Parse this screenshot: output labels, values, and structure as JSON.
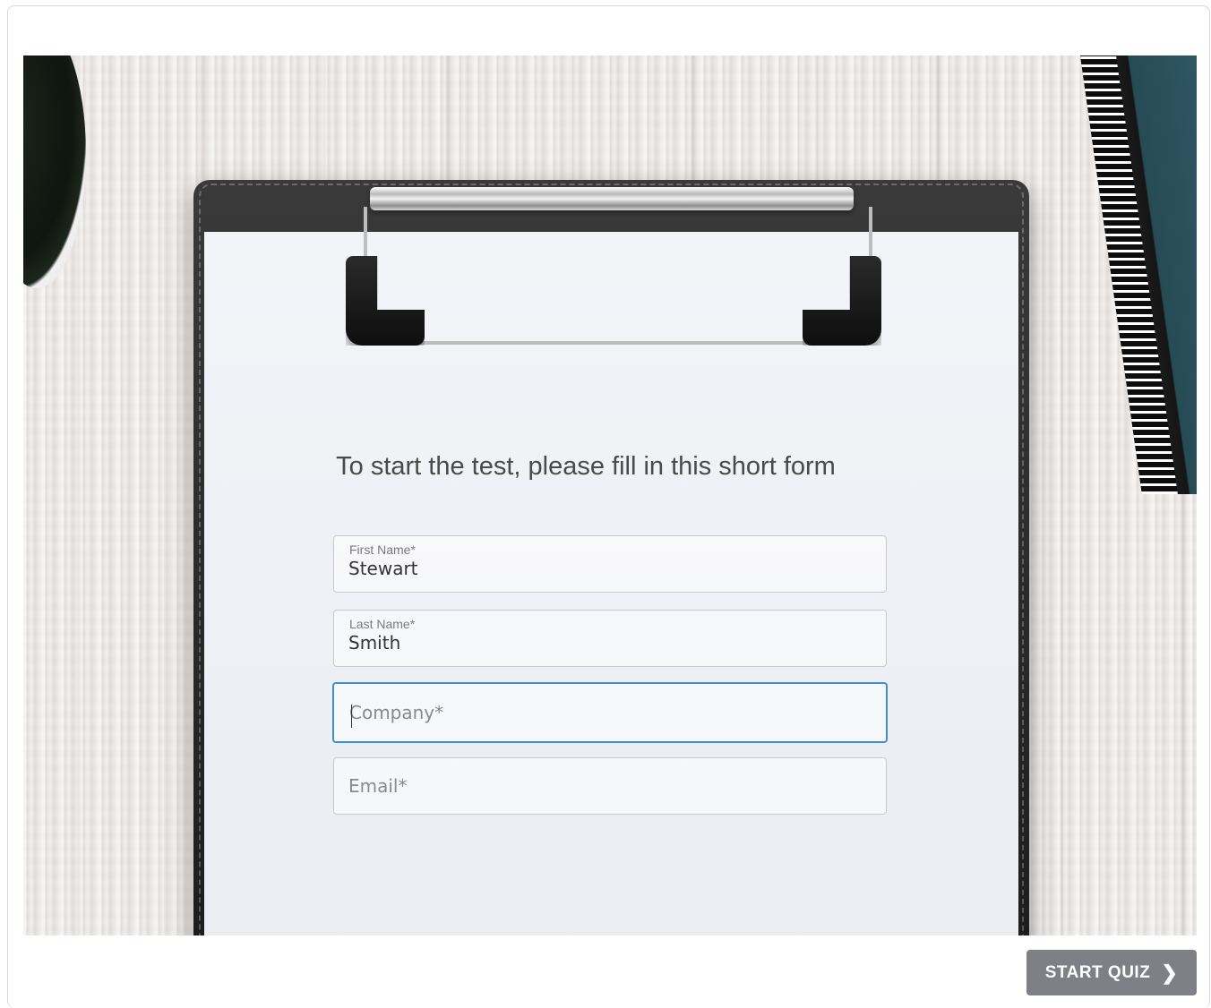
{
  "form": {
    "title": "To start the test, please fill in this short form",
    "first_name": {
      "label": "First Name*",
      "value": "Stewart"
    },
    "last_name": {
      "label": "Last Name*",
      "value": "Smith"
    },
    "company": {
      "placeholder": "Company*",
      "value": ""
    },
    "email": {
      "placeholder": "Email*",
      "value": ""
    }
  },
  "footer": {
    "start_label": "START QUIZ",
    "start_icon": "chevron-right-icon"
  }
}
